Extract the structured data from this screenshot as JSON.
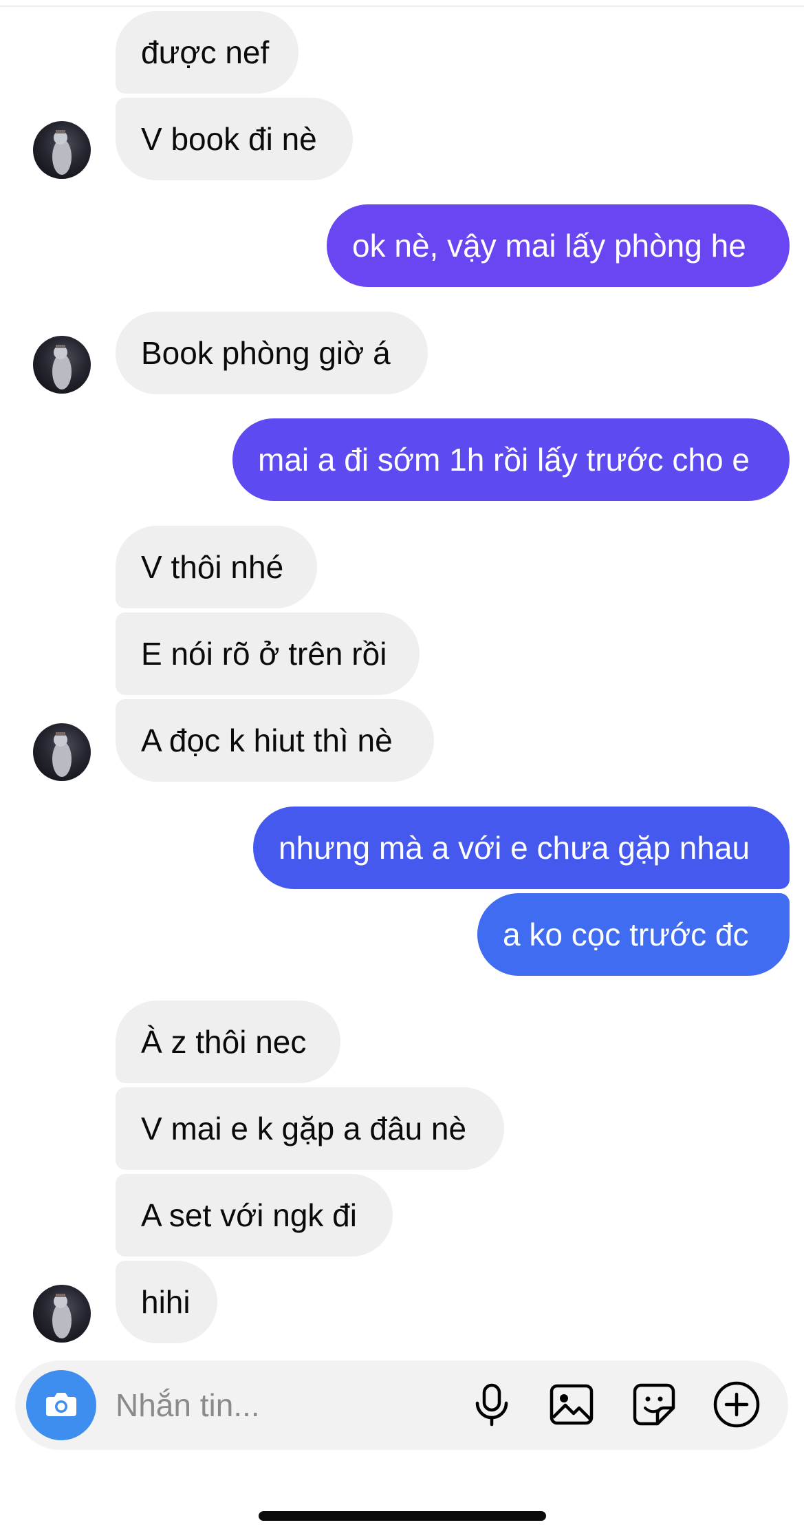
{
  "conversation": {
    "messages": [
      {
        "sender": "them",
        "text": "được nef"
      },
      {
        "sender": "them",
        "text": "V book đi nè"
      },
      {
        "sender": "me",
        "text": "ok nè, vậy mai lấy phòng he"
      },
      {
        "sender": "them",
        "text": "Book phòng giờ á"
      },
      {
        "sender": "me",
        "text": "mai a đi sớm 1h rồi lấy trước cho e"
      },
      {
        "sender": "them",
        "text": "V thôi nhé"
      },
      {
        "sender": "them",
        "text": "E nói rõ ở trên rồi"
      },
      {
        "sender": "them",
        "text": "A đọc k hiut thì nè"
      },
      {
        "sender": "me",
        "text": "nhưng mà a với e chưa gặp nhau"
      },
      {
        "sender": "me",
        "text": "a ko cọc trước đc"
      },
      {
        "sender": "them",
        "text": "À z thôi nec"
      },
      {
        "sender": "them",
        "text": "V mai e k gặp a đâu nè"
      },
      {
        "sender": "them",
        "text": "A set với ngk đi"
      },
      {
        "sender": "them",
        "text": "hihi"
      }
    ]
  },
  "composer": {
    "placeholder": "Nhắn tin...",
    "value": "",
    "icons": [
      "camera-icon",
      "microphone-icon",
      "image-icon",
      "sticker-icon",
      "plus-icon"
    ]
  },
  "colors": {
    "incoming_bubble": "#efefef",
    "outgoing_purple": "#6a45f2",
    "outgoing_violet": "#5d4bf1",
    "outgoing_blue": "#3f6cf0",
    "camera_button": "#3e8ef0"
  }
}
